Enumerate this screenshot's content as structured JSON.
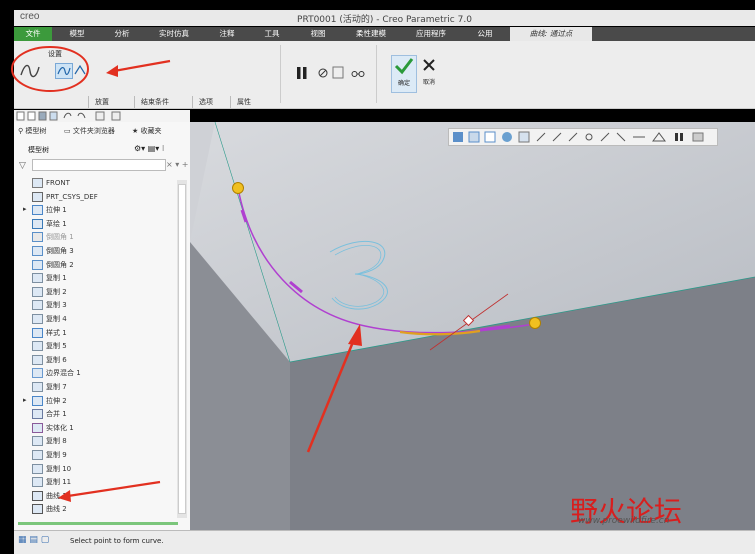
{
  "window": {
    "logo": "creo",
    "title": "PRT0001 (活动的) - Creo Parametric 7.0"
  },
  "ribbon_tabs": [
    {
      "label": "文件"
    },
    {
      "label": "模型"
    },
    {
      "label": "分析"
    },
    {
      "label": "实时仿真"
    },
    {
      "label": "注释"
    },
    {
      "label": "工具"
    },
    {
      "label": "视图"
    },
    {
      "label": "柔性建模"
    },
    {
      "label": "应用程序"
    },
    {
      "label": "公用"
    },
    {
      "label": "曲线: 通过点"
    }
  ],
  "ribbon": {
    "settings_group_label": "设置",
    "subtabs": [
      "放置",
      "结束条件",
      "选项",
      "属性"
    ],
    "confirm_label": "确定",
    "cancel_label": "取消"
  },
  "panel": {
    "tabs": [
      "模型树",
      "文件夹浏览器",
      "收藏夹"
    ],
    "header": "模型树",
    "tree_items": [
      {
        "label": "FRONT",
        "icon": "datum-plane-icon",
        "expand": false,
        "dim": false
      },
      {
        "label": "PRT_CSYS_DEF",
        "icon": "csys-icon",
        "expand": false,
        "dim": false
      },
      {
        "label": "拉伸 1",
        "icon": "extrude-icon",
        "expand": true,
        "dim": false
      },
      {
        "label": "草绘 1",
        "icon": "sketch-icon",
        "expand": false,
        "dim": false
      },
      {
        "label": "倒圆角 1",
        "icon": "round-icon",
        "expand": false,
        "dim": true
      },
      {
        "label": "倒圆角 3",
        "icon": "round-icon",
        "expand": false,
        "dim": false
      },
      {
        "label": "倒圆角 2",
        "icon": "round-icon",
        "expand": false,
        "dim": false
      },
      {
        "label": "复制 1",
        "icon": "copy-icon",
        "expand": false,
        "dim": false
      },
      {
        "label": "复制 2",
        "icon": "copy-icon",
        "expand": false,
        "dim": false
      },
      {
        "label": "复制 3",
        "icon": "copy-icon",
        "expand": false,
        "dim": false
      },
      {
        "label": "复制 4",
        "icon": "copy-icon",
        "expand": false,
        "dim": false
      },
      {
        "label": "样式 1",
        "icon": "style-icon",
        "expand": false,
        "dim": false
      },
      {
        "label": "复制 5",
        "icon": "copy-icon",
        "expand": false,
        "dim": false
      },
      {
        "label": "复制 6",
        "icon": "copy-icon",
        "expand": false,
        "dim": false
      },
      {
        "label": "边界混合 1",
        "icon": "boundary-blend-icon",
        "expand": false,
        "dim": false
      },
      {
        "label": "复制 7",
        "icon": "copy-icon",
        "expand": false,
        "dim": false
      },
      {
        "label": "拉伸 2",
        "icon": "extrude-icon",
        "expand": true,
        "dim": false
      },
      {
        "label": "合并 1",
        "icon": "merge-icon",
        "expand": false,
        "dim": false
      },
      {
        "label": "实体化 1",
        "icon": "solidify-icon",
        "expand": false,
        "dim": false
      },
      {
        "label": "复制 8",
        "icon": "copy-icon",
        "expand": false,
        "dim": false
      },
      {
        "label": "复制 9",
        "icon": "copy-icon",
        "expand": false,
        "dim": false
      },
      {
        "label": "复制 10",
        "icon": "copy-icon",
        "expand": false,
        "dim": false
      },
      {
        "label": "复制 11",
        "icon": "copy-icon",
        "expand": false,
        "dim": false
      },
      {
        "label": "曲线 1",
        "icon": "curve-icon",
        "expand": false,
        "dim": false
      },
      {
        "label": "曲线 2",
        "icon": "curve-icon",
        "expand": false,
        "dim": false
      }
    ]
  },
  "status": {
    "message": "Select point to form curve."
  },
  "watermark": {
    "brand": "野火论坛",
    "url": "www.proewildfire.cn"
  },
  "colors": {
    "file_tab": "#3c9a3c",
    "curve": "#b040d0",
    "curve_highlight": "#e0a020",
    "point_marker": "#f0c020",
    "annotation": "#e23020"
  }
}
